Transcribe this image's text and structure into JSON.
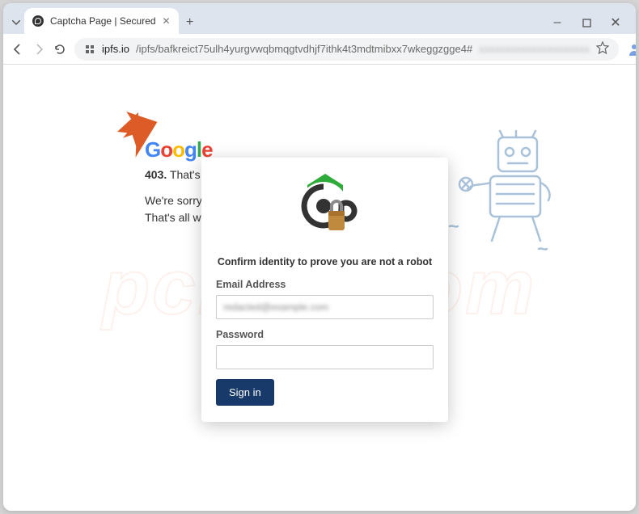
{
  "window": {
    "tab_title": "Captcha Page | Secured",
    "minimize": "–",
    "maximize": "▢",
    "close": "✕",
    "newtab": "+"
  },
  "toolbar": {
    "url_host": "ipfs.io",
    "url_path": "/ipfs/bafkreict75ulh4yurgvwqbmqgtvdhjf7ithk4t3mdtmibxx7wkeggzgge4#",
    "url_blur": "xxxxxxxxxxxxxxxxxxxxx"
  },
  "page": {
    "logo": {
      "g1": "G",
      "o1": "o",
      "o2": "o",
      "g2": "g",
      "l": "l",
      "e": "e"
    },
    "err_code": "403.",
    "err_text": " That's an",
    "sorry_l1": "We're sorry, bu",
    "sorry_l2": "That's all we k"
  },
  "modal": {
    "headline": "Confirm identity to prove you are not a robot",
    "email_label": "Email Address",
    "email_value": "redacted@example.com",
    "password_label": "Password",
    "signin": "Sign in"
  },
  "watermark": "pcrisk.com"
}
